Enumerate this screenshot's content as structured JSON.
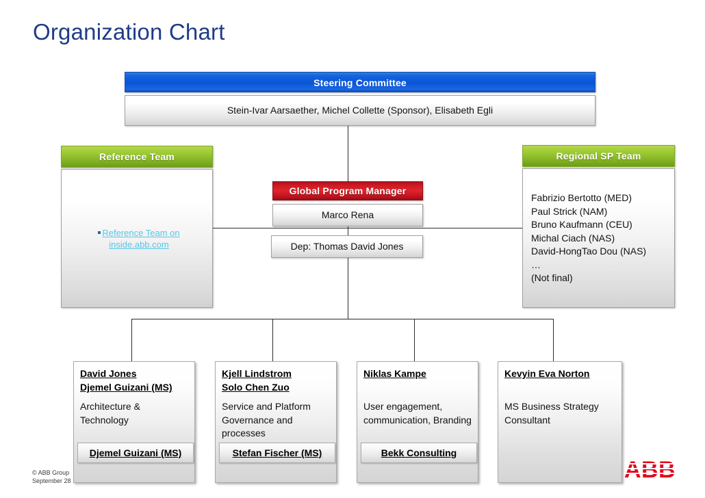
{
  "slide": {
    "title": "Organization Chart",
    "title_color": "#1F3C88"
  },
  "steering_committee": {
    "header": "Steering Committee",
    "header_color": "#0a55d6",
    "members": "Stein-Ivar Aarsaether, Michel Collette (Sponsor), Elisabeth Egli"
  },
  "reference_team": {
    "header": "Reference Team",
    "header_color": "#84b425",
    "link_text": "Reference Team on inside.abb.com",
    "link_color": "#56c6e8"
  },
  "regional_sp_team": {
    "header": "Regional SP Team",
    "header_color": "#84b425",
    "members": [
      "Fabrizio Bertotto (MED)",
      "Paul Strick (NAM)",
      "Bruno Kaufmann (CEU)",
      "Michal Ciach (NAS)",
      "David-HongTao Dou (NAS)",
      "…",
      "(Not final)"
    ]
  },
  "global_program_manager": {
    "header": "Global Program Manager",
    "header_color": "#e0242c",
    "manager": "Marco Rena",
    "deputy": "Dep: Thomas David Jones"
  },
  "workstreams": [
    {
      "names": [
        "David Jones",
        "Djemel Guizani (MS)"
      ],
      "description": "Architecture & Technology",
      "partner": "Djemel Guizani (MS)"
    },
    {
      "names": [
        "Kjell Lindstrom",
        "Solo Chen Zuo"
      ],
      "description": "Service and Platform Governance and processes",
      "partner": "Stefan Fischer (MS)"
    },
    {
      "names": [
        "Niklas Kampe"
      ],
      "description": "User engagement, communication, Branding",
      "partner": "Bekk Consulting"
    },
    {
      "names": [
        "Kevyin Eva Norton"
      ],
      "description": "MS Business Strategy Consultant",
      "partner": ""
    }
  ],
  "footer": {
    "copyright": "© ABB Group",
    "date": "September 28"
  },
  "logo": {
    "text": "ABB",
    "color": "#e2001a"
  }
}
